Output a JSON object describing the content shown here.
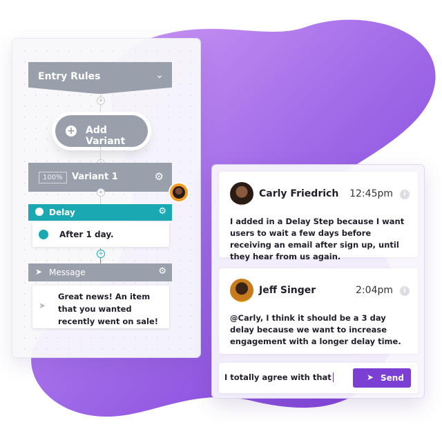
{
  "flow": {
    "entry_rules_label": "Entry Rules",
    "add_variant_label": "Add Variant",
    "variant": {
      "percent": "100%",
      "label": "Variant 1"
    },
    "delay": {
      "header": "Delay",
      "text": "After 1 day."
    },
    "message": {
      "header": "Message",
      "text": "Great news! An item that you wanted recently went on sale!"
    }
  },
  "chat": {
    "messages": [
      {
        "author": "Carly Friedrich",
        "time": "12:45pm",
        "text": "I added in a Delay Step because I want users to wait a few days before receiving an email after sign up, until they hear from us again."
      },
      {
        "author": "Jeff Singer",
        "time": "2:04pm",
        "text": "@Carly, I think it should be a 3 day delay because we want to increase engagement with a longer delay time."
      }
    ],
    "composer": {
      "value": "I totally agree with that"
    },
    "send_label": "Send"
  },
  "icons": [
    "chevron-down-icon",
    "plus-icon",
    "gear-icon",
    "clock-icon",
    "send-icon",
    "info-icon"
  ],
  "colors": {
    "accent": "#7b3fd4",
    "teal": "#1aa9b3",
    "grey_node": "#9aa0ab",
    "blob": "#9b5ee5"
  }
}
